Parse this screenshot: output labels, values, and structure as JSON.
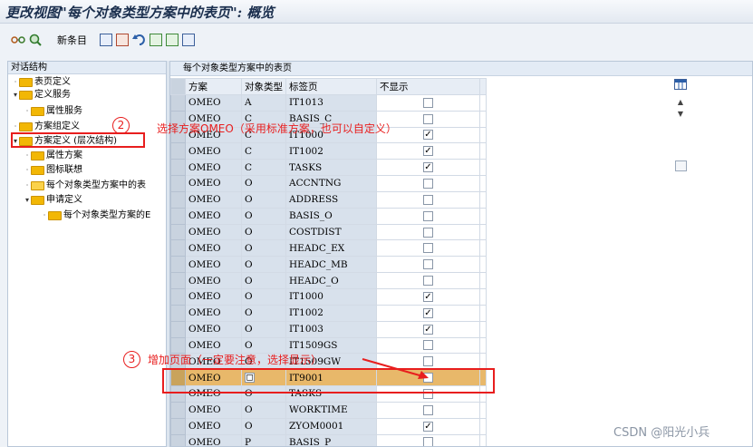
{
  "window": {
    "title": "更改视图\"每个对象类型方案中的表页\": 概览"
  },
  "toolbar": {
    "new_entry_label": "新条目",
    "icons": [
      "glasses-icon",
      "find-icon",
      "copy-icon",
      "details-icon",
      "undo-icon",
      "select-all-icon",
      "select-block-icon",
      "deselect-all-icon"
    ]
  },
  "left_panel": {
    "title": "对话结构",
    "nodes": [
      {
        "label": "表页定义",
        "expand": "·"
      },
      {
        "label": "定义服务",
        "expand": "▾"
      },
      {
        "label": "属性服务",
        "expand": "·"
      },
      {
        "label": "方案组定义",
        "expand": "·"
      },
      {
        "label": "方案定义 (层次结构)",
        "expand": "▾"
      },
      {
        "label": "属性方案",
        "expand": "·"
      },
      {
        "label": "图标联想",
        "expand": "·"
      },
      {
        "label": "每个对象类型方案中的表",
        "expand": "·"
      },
      {
        "label": "申请定义",
        "expand": "▾"
      },
      {
        "label": "每个对象类型方案的E",
        "expand": "·"
      }
    ]
  },
  "table": {
    "title": "每个对象类型方案中的表页",
    "columns": [
      "方案",
      "对象类型",
      "标签页",
      "不显示"
    ],
    "rows": [
      {
        "scheme": "OMEO",
        "otype": "A",
        "tab": "IT1013",
        "hide": false
      },
      {
        "scheme": "OMEO",
        "otype": "C",
        "tab": "BASIS_C",
        "hide": false
      },
      {
        "scheme": "OMEO",
        "otype": "C",
        "tab": "IT1000",
        "hide": true
      },
      {
        "scheme": "OMEO",
        "otype": "C",
        "tab": "IT1002",
        "hide": true
      },
      {
        "scheme": "OMEO",
        "otype": "C",
        "tab": "TASKS",
        "hide": true
      },
      {
        "scheme": "OMEO",
        "otype": "O",
        "tab": "ACCNTNG",
        "hide": false
      },
      {
        "scheme": "OMEO",
        "otype": "O",
        "tab": "ADDRESS",
        "hide": false
      },
      {
        "scheme": "OMEO",
        "otype": "O",
        "tab": "BASIS_O",
        "hide": false
      },
      {
        "scheme": "OMEO",
        "otype": "O",
        "tab": "COSTDIST",
        "hide": false
      },
      {
        "scheme": "OMEO",
        "otype": "O",
        "tab": "HEADC_EX",
        "hide": false
      },
      {
        "scheme": "OMEO",
        "otype": "O",
        "tab": "HEADC_MB",
        "hide": false
      },
      {
        "scheme": "OMEO",
        "otype": "O",
        "tab": "HEADC_O",
        "hide": false
      },
      {
        "scheme": "OMEO",
        "otype": "O",
        "tab": "IT1000",
        "hide": true
      },
      {
        "scheme": "OMEO",
        "otype": "O",
        "tab": "IT1002",
        "hide": true
      },
      {
        "scheme": "OMEO",
        "otype": "O",
        "tab": "IT1003",
        "hide": true
      },
      {
        "scheme": "OMEO",
        "otype": "O",
        "tab": "IT1509GS",
        "hide": false
      },
      {
        "scheme": "OMEO",
        "otype": "O",
        "tab": "IT1509GW",
        "hide": false
      },
      {
        "scheme": "OMEO",
        "otype": "O",
        "tab": "IT9001",
        "hide": false,
        "highlight": true
      },
      {
        "scheme": "OMEO",
        "otype": "O",
        "tab": "TASKS",
        "hide": false
      },
      {
        "scheme": "OMEO",
        "otype": "O",
        "tab": "WORKTIME",
        "hide": false
      },
      {
        "scheme": "OMEO",
        "otype": "O",
        "tab": "ZYOM0001",
        "hide": true
      },
      {
        "scheme": "OMEO",
        "otype": "P",
        "tab": "BASIS_P",
        "hide": false
      }
    ]
  },
  "annotations": {
    "circle2": "2",
    "note2": "选择方案OMEO（采用标准方案，也可以自定义）",
    "circle3": "3",
    "note3": "增加页面（一定要注意，选择显示）"
  },
  "watermark": "CSDN @阳光小兵",
  "colors": {
    "annotation": "#e81e1e",
    "highlight_row": "#e8b86a",
    "folder": "#f2b705"
  }
}
